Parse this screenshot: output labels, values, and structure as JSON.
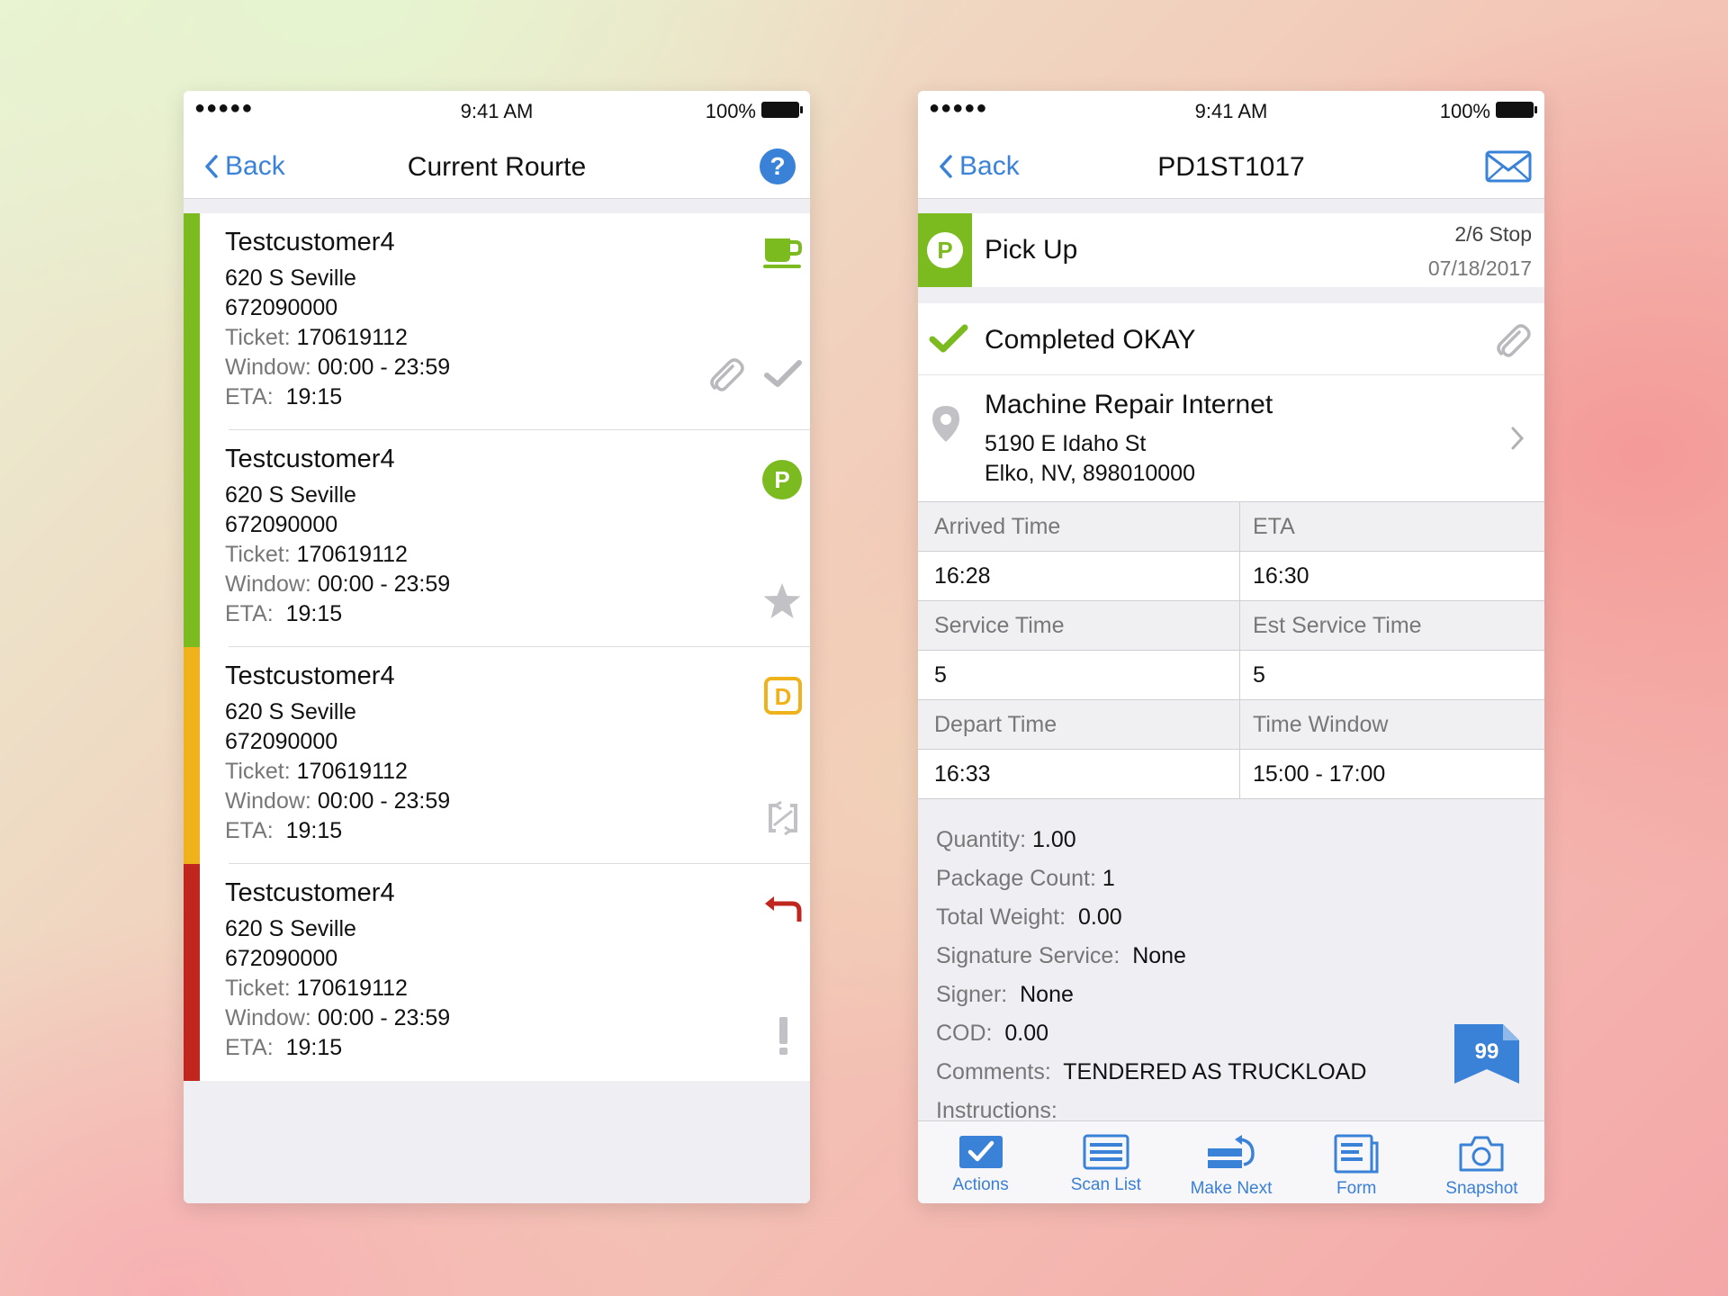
{
  "colors": {
    "accent_blue": "#3a82d8",
    "green": "#7cbb1f",
    "yellow": "#f0b21b",
    "red": "#c0261e",
    "muted_gray": "#777777"
  },
  "status_bar": {
    "signal": "●●●●●",
    "time": "9:41 AM",
    "battery": "100%"
  },
  "left_screen": {
    "nav": {
      "back_label": "Back",
      "title": "Current Rourte",
      "right_icon": "help-icon"
    },
    "items": [
      {
        "strip_color": "green",
        "name": "Testcustomer4",
        "address": "620 S Seville",
        "phone": "672090000",
        "ticket_label": "Ticket:",
        "ticket": "170619112",
        "window_label": "Window:",
        "window": "00:00 - 23:59",
        "eta_label": "ETA:",
        "eta": "19:15",
        "top_icon": "coffee-cup-icon",
        "bottom_icon": "checkmark-icon",
        "extra_icon": "paperclip-icon"
      },
      {
        "strip_color": "green",
        "name": "Testcustomer4",
        "address": "620 S Seville",
        "phone": "672090000",
        "ticket_label": "Ticket:",
        "ticket": "170619112",
        "window_label": "Window:",
        "window": "00:00 - 23:59",
        "eta_label": "ETA:",
        "eta": "19:15",
        "top_icon": "pickup-p-icon",
        "top_icon_text": "P",
        "bottom_icon": "star-icon"
      },
      {
        "strip_color": "yellow",
        "name": "Testcustomer4",
        "address": "620 S Seville",
        "phone": "672090000",
        "ticket_label": "Ticket:",
        "ticket": "170619112",
        "window_label": "Window:",
        "window": "00:00 - 23:59",
        "eta_label": "ETA:",
        "eta": "19:15",
        "top_icon": "delivery-d-icon",
        "top_icon_text": "D",
        "bottom_icon": "swap-icon"
      },
      {
        "strip_color": "red",
        "name": "Testcustomer4",
        "address": "620 S Seville",
        "phone": "672090000",
        "ticket_label": "Ticket:",
        "ticket": "170619112",
        "window_label": "Window:",
        "window": "00:00 - 23:59",
        "eta_label": "ETA:",
        "eta": "19:15",
        "top_icon": "return-arrow-icon",
        "bottom_icon": "exclamation-icon"
      }
    ]
  },
  "right_screen": {
    "nav": {
      "back_label": "Back",
      "title": "PD1ST1017",
      "right_icon": "mail-icon"
    },
    "stop": {
      "type_letter": "P",
      "type_label": "Pick Up",
      "stop_count": "2/6 Stop",
      "date": "07/18/2017"
    },
    "status": {
      "text": "Completed OKAY"
    },
    "location": {
      "name": "Machine Repair Internet",
      "street": "5190 E Idaho St",
      "city": "Elko, NV, 898010000"
    },
    "grid": [
      {
        "left_label": "Arrived Time",
        "right_label": "ETA",
        "left_value": "16:28",
        "right_value": "16:30"
      },
      {
        "left_label": "Service Time",
        "right_label": "Est Service Time",
        "left_value": "5",
        "right_value": "5"
      },
      {
        "left_label": "Depart Time",
        "right_label": "Time Window",
        "left_value": "16:33",
        "right_value": "15:00 - 17:00"
      }
    ],
    "details": {
      "quantity_label": "Quantity:",
      "quantity": "1.00",
      "package_count_label": "Package Count:",
      "package_count": "1",
      "total_weight_label": "Total Weight:",
      "total_weight": "0.00",
      "signature_service_label": "Signature Service:",
      "signature_service": "None",
      "signer_label": "Signer:",
      "signer": "None",
      "cod_label": "COD:",
      "cod": "0.00",
      "comments_label": "Comments:",
      "comments": "TENDERED AS TRUCKLOAD",
      "instructions_label": "Instructions:",
      "badge_count": "99"
    },
    "tabs": [
      {
        "label": "Actions",
        "icon": "checkbox-icon"
      },
      {
        "label": "Scan List",
        "icon": "list-icon"
      },
      {
        "label": "Make Next",
        "icon": "make-next-icon"
      },
      {
        "label": "Form",
        "icon": "form-icon"
      },
      {
        "label": "Snapshot",
        "icon": "camera-icon"
      }
    ]
  }
}
